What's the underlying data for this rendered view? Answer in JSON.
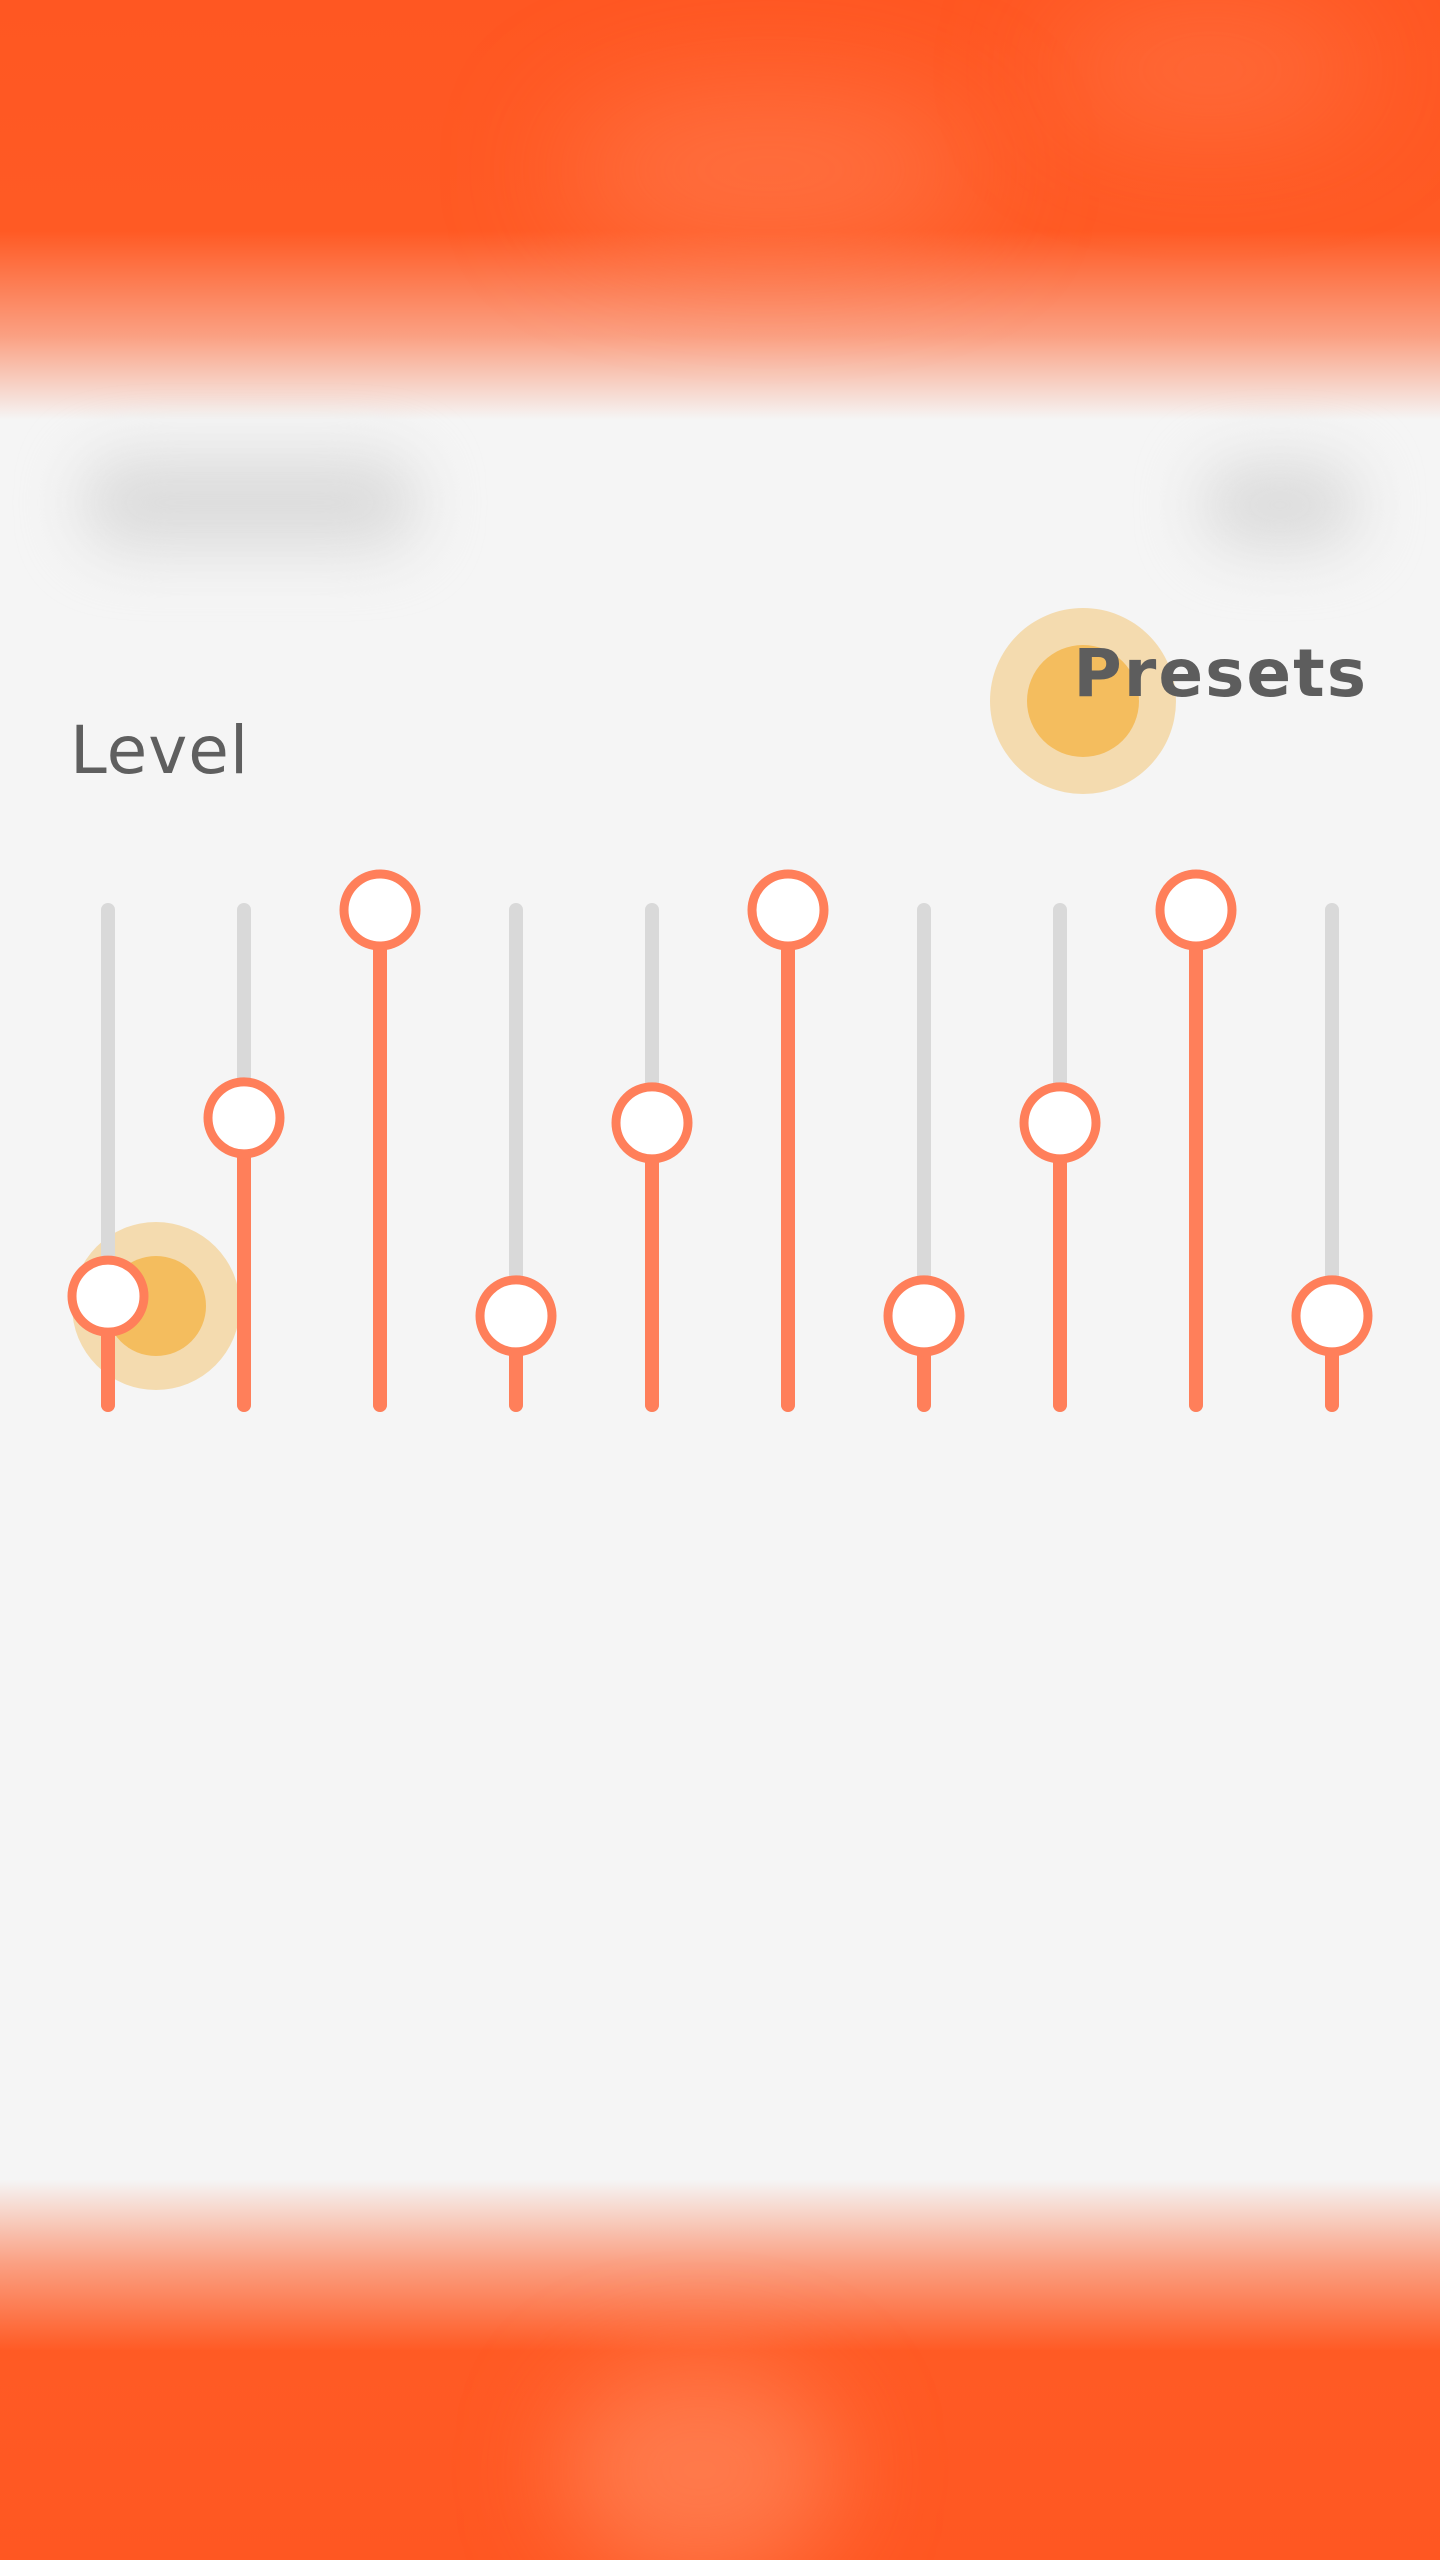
{
  "presets_label": "Presets",
  "level_label": "Level",
  "colors": {
    "accent": "#ff7f5a",
    "track": "#d9d9d9",
    "header": "#ff5722",
    "touch": "#f3b750"
  },
  "equalizer": {
    "bands": [
      {
        "level": 0.22
      },
      {
        "level": 0.58
      },
      {
        "level": 1.0
      },
      {
        "level": 0.18
      },
      {
        "level": 0.57
      },
      {
        "level": 1.0
      },
      {
        "level": 0.18
      },
      {
        "level": 0.57
      },
      {
        "level": 1.0
      },
      {
        "level": 0.18
      }
    ]
  }
}
